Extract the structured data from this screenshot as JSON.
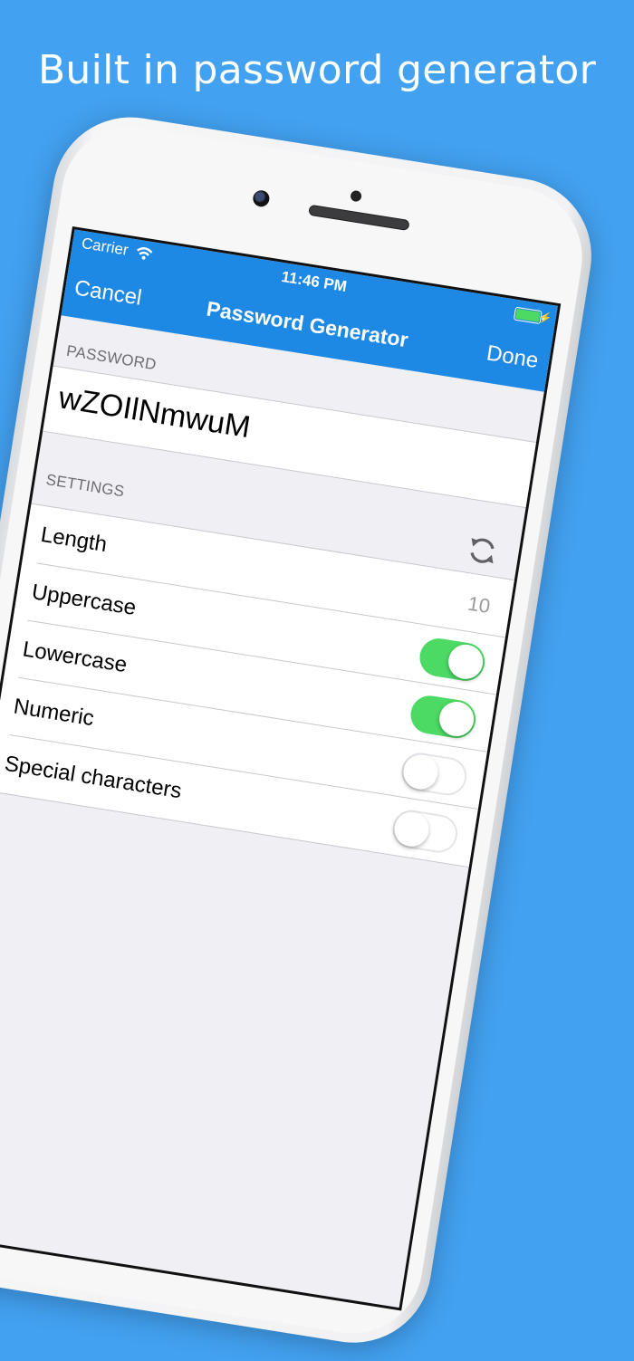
{
  "headline": "Built in password generator",
  "status_bar": {
    "carrier": "Carrier",
    "time": "11:46 PM"
  },
  "navbar": {
    "cancel_label": "Cancel",
    "title": "Password Generator",
    "done_label": "Done"
  },
  "password_section": {
    "header": "PASSWORD",
    "value": "wZOIlNmwuM"
  },
  "settings_section": {
    "header": "SETTINGS",
    "rows": [
      {
        "label": "Length",
        "value": "10"
      },
      {
        "label": "Uppercase",
        "enabled": true
      },
      {
        "label": "Lowercase",
        "enabled": true
      },
      {
        "label": "Numeric",
        "enabled": false
      },
      {
        "label": "Special characters",
        "enabled": false
      }
    ]
  },
  "colors": {
    "background": "#43a1f1",
    "navbar": "#1e88e5",
    "switch_on": "#4cd964"
  },
  "icons": [
    "wifi-icon",
    "battery-icon",
    "refresh-icon"
  ]
}
